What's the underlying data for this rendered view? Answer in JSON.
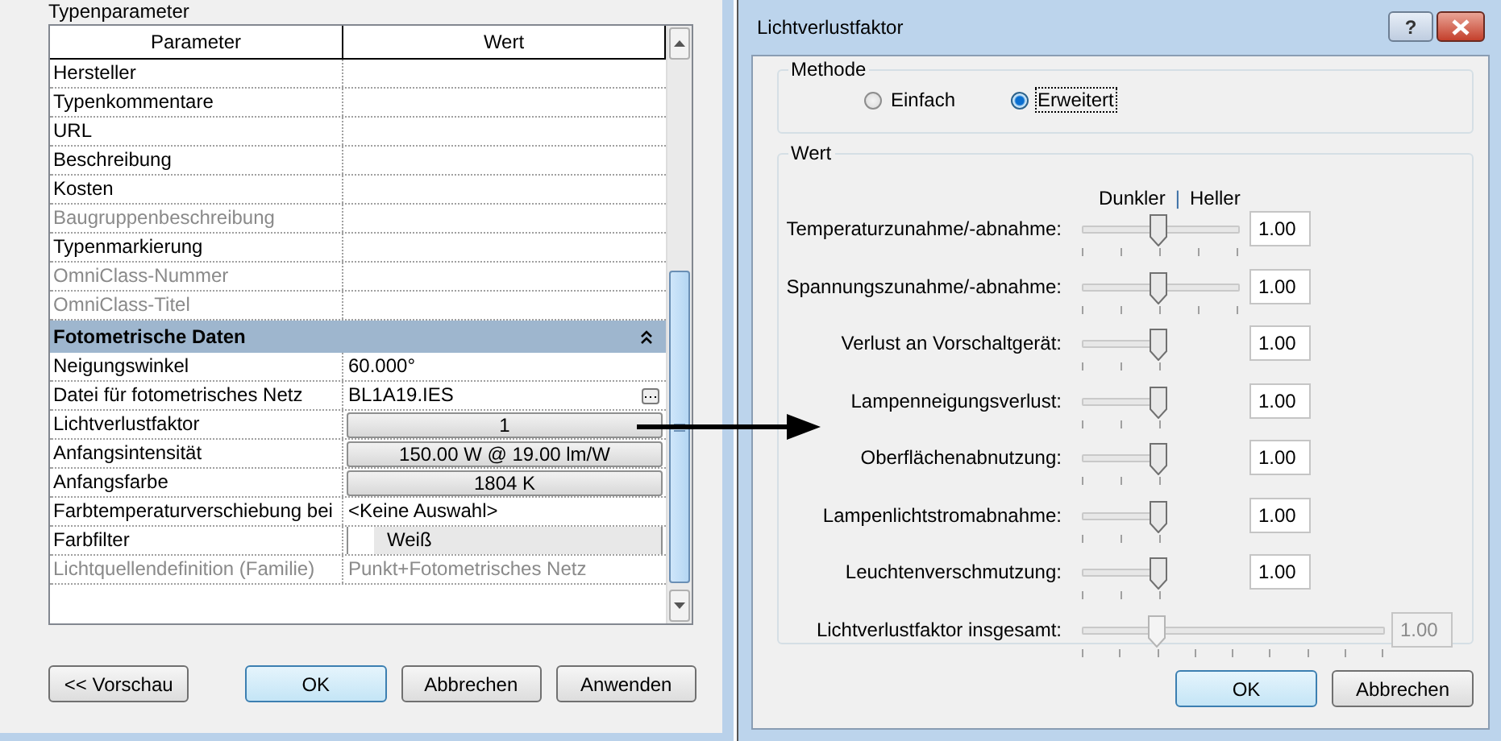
{
  "left_dialog": {
    "section_title": "Typenparameter",
    "table": {
      "columns": [
        "Parameter",
        "Wert"
      ],
      "rows": [
        {
          "kind": "param",
          "name": "Hersteller",
          "disabled": false
        },
        {
          "kind": "param",
          "name": "Typenkommentare",
          "disabled": false
        },
        {
          "kind": "param",
          "name": "URL",
          "disabled": false
        },
        {
          "kind": "param",
          "name": "Beschreibung",
          "disabled": false
        },
        {
          "kind": "param",
          "name": "Kosten",
          "disabled": false
        },
        {
          "kind": "param",
          "name": "Baugruppenbeschreibung",
          "disabled": true
        },
        {
          "kind": "param",
          "name": "Typenmarkierung",
          "disabled": false
        },
        {
          "kind": "param",
          "name": "OmniClass-Nummer",
          "disabled": true
        },
        {
          "kind": "param",
          "name": "OmniClass-Titel",
          "disabled": true
        },
        {
          "kind": "group",
          "name": "Fotometrische Daten",
          "expanded": true
        },
        {
          "kind": "param",
          "name": "Neigungswinkel",
          "value": {
            "kind": "text",
            "text": "60.000°"
          },
          "disabled": false
        },
        {
          "kind": "param",
          "name": "Datei für fotometrisches Netz",
          "value": {
            "kind": "file",
            "text": "BL1A19.IES"
          },
          "disabled": false
        },
        {
          "kind": "param",
          "name": "Lichtverlustfaktor",
          "value": {
            "kind": "button",
            "text": "1"
          },
          "disabled": false
        },
        {
          "kind": "param",
          "name": "Anfangsintensität",
          "value": {
            "kind": "button",
            "text": "150.00 W @ 19.00 lm/W"
          },
          "disabled": false
        },
        {
          "kind": "param",
          "name": "Anfangsfarbe",
          "value": {
            "kind": "button",
            "text": "1804 K"
          },
          "disabled": false
        },
        {
          "kind": "param",
          "name": "Farbtemperaturverschiebung bei",
          "value": {
            "kind": "text",
            "text": "<Keine Auswahl>"
          },
          "disabled": false
        },
        {
          "kind": "param",
          "name": "Farbfilter",
          "value": {
            "kind": "color",
            "text": "Weiß",
            "color": "#ffffff"
          },
          "disabled": false
        },
        {
          "kind": "param",
          "name": "Lichtquellendefinition (Familie)",
          "value": {
            "kind": "text",
            "text": "Punkt+Fotometrisches Netz"
          },
          "disabled": true
        }
      ]
    },
    "buttons": [
      {
        "label": "<< Vorschau",
        "default": false
      },
      {
        "label": "OK",
        "default": true
      },
      {
        "label": "Abbrechen",
        "default": false
      },
      {
        "label": "Anwenden",
        "default": false
      }
    ]
  },
  "right_dialog": {
    "title": "Lichtverlustfaktor",
    "help_button": "?",
    "method_group": {
      "title": "Methode",
      "options": [
        {
          "label": "Einfach",
          "selected": false
        },
        {
          "label": "Erweitert",
          "selected": true
        }
      ]
    },
    "value_group": {
      "title": "Wert",
      "scale_left": "Dunkler",
      "scale_separator": "|",
      "scale_right": "Heller",
      "sliders": [
        {
          "kind": "bidirectional",
          "label": "Temperaturzunahme/-abnahme:",
          "level": 0.5,
          "value": "1.00",
          "disabled": false
        },
        {
          "kind": "bidirectional",
          "label": "Spannungszunahme/-abnahme:",
          "level": 0.5,
          "value": "1.00",
          "disabled": false
        },
        {
          "kind": "loss",
          "label": "Verlust an Vorschaltgerät:",
          "level": 1,
          "value": "1.00",
          "disabled": false
        },
        {
          "kind": "loss",
          "label": "Lampenneigungsverlust:",
          "level": 1,
          "value": "1.00",
          "disabled": false
        },
        {
          "kind": "loss",
          "label": "Oberflächenabnutzung:",
          "level": 1,
          "value": "1.00",
          "disabled": false
        },
        {
          "kind": "loss",
          "label": "Lampenlichtstromabnahme:",
          "level": 1,
          "value": "1.00",
          "disabled": false
        },
        {
          "kind": "loss",
          "label": "Leuchtenverschmutzung:",
          "level": 1,
          "value": "1.00",
          "disabled": false
        },
        {
          "kind": "total",
          "label": "Lichtverlustfaktor insgesamt:",
          "level": 0.25,
          "value": "1.00",
          "disabled": true
        }
      ]
    },
    "buttons": [
      {
        "label": "OK",
        "default": true
      },
      {
        "label": "Abbrechen",
        "default": false
      }
    ]
  }
}
